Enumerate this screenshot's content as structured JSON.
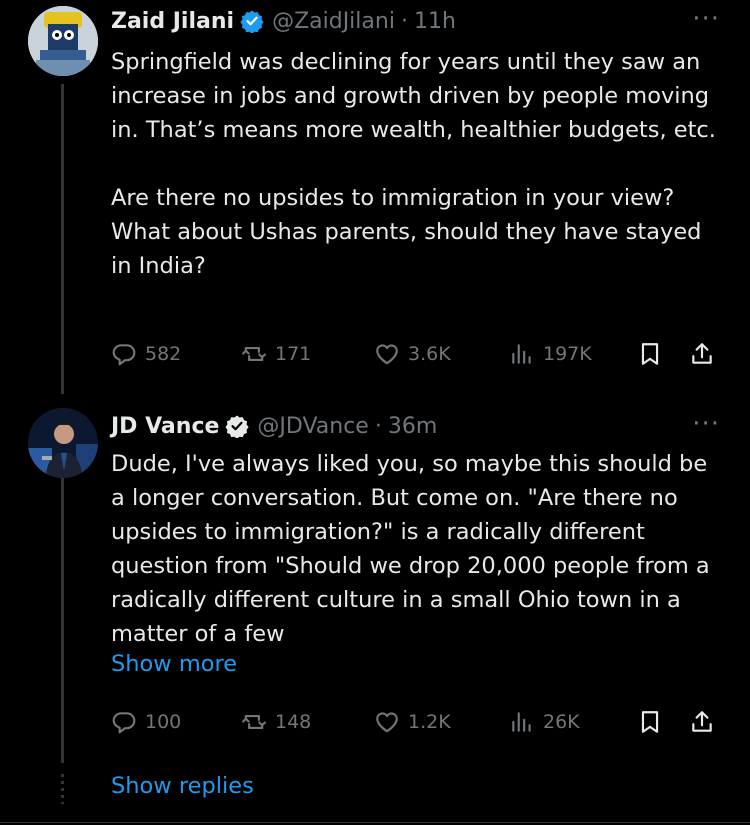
{
  "colors": {
    "background": "#000000",
    "text": "#e7e9ea",
    "muted": "#71767b",
    "accent": "#1d9bf0",
    "verified": "#1d9bf0"
  },
  "tweets": [
    {
      "name": "Zaid Jilani",
      "verified": true,
      "handle": "@ZaidJilani",
      "separator": "·",
      "time": "11h",
      "more_icon": "···",
      "text": "Springfield was declining for years until they saw an increase in jobs and growth driven by people moving in. That’s means more wealth, healthier budgets, etc.\n\nAre there no upsides to immigration in your view? What about Ushas parents, should they have stayed in India?",
      "stats": {
        "replies": "582",
        "reposts": "171",
        "likes": "3.6K",
        "views": "197K"
      }
    },
    {
      "name": "JD Vance",
      "verified": true,
      "handle": "@JDVance",
      "separator": "·",
      "time": "36m",
      "more_icon": "···",
      "text": "Dude, I've always liked you, so maybe this should be a longer conversation. But come on. \"Are there no upsides to immigration?\" is a radically different question from \"Should we drop 20,000 people from a radically different culture in a small Ohio town in a matter of a few",
      "show_more": "Show more",
      "stats": {
        "replies": "100",
        "reposts": "148",
        "likes": "1.2K",
        "views": "26K"
      }
    }
  ],
  "show_replies": "Show replies"
}
